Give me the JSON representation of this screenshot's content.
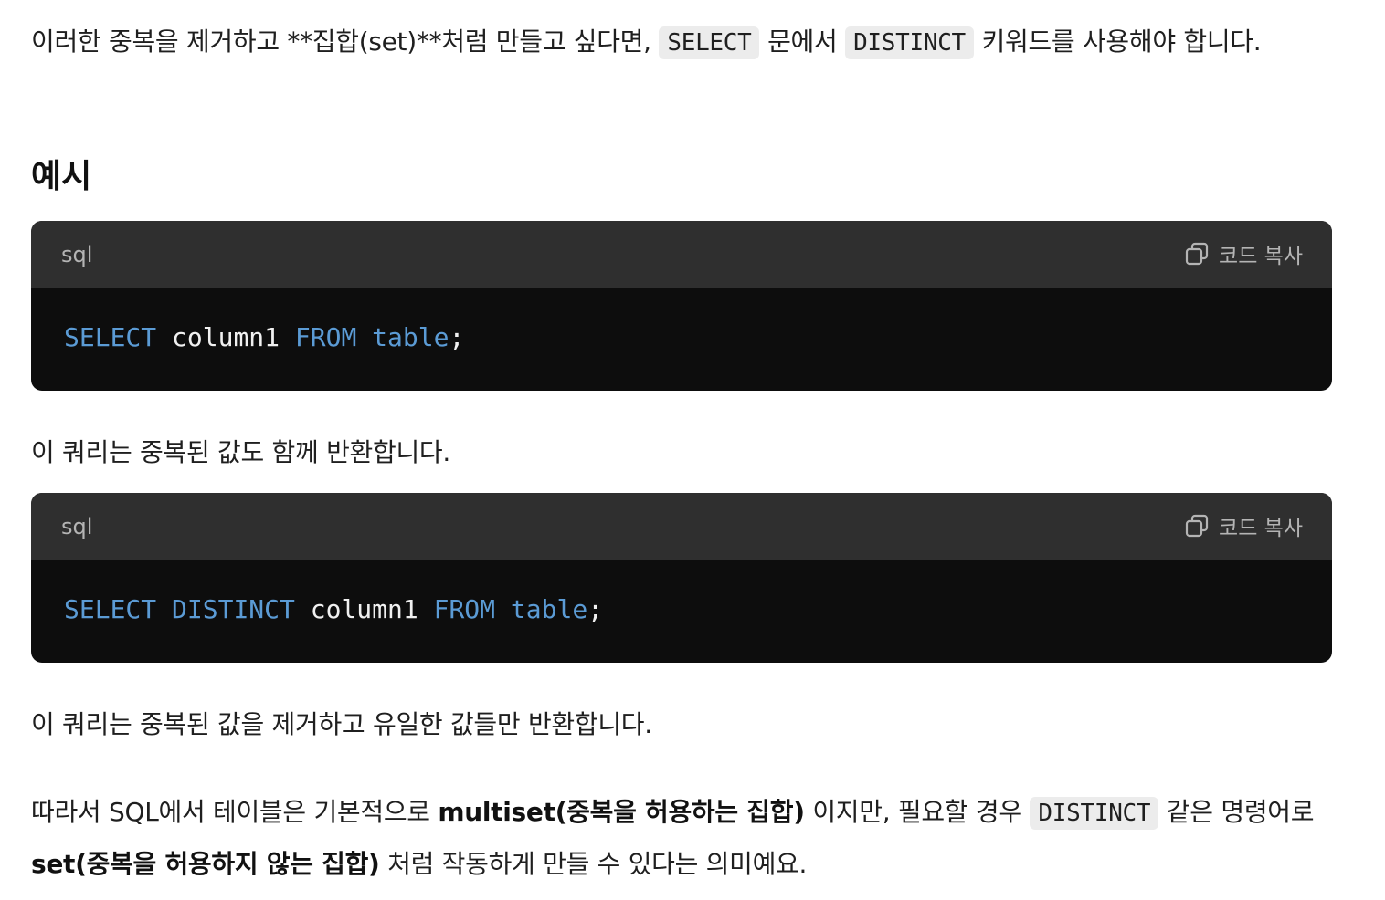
{
  "intro": {
    "text_before": "이러한 중복을 제거하고 **집합(set)**처럼 만들고 싶다면, ",
    "code1": "SELECT",
    "text_mid": " 문에서 ",
    "code2": "DISTINCT",
    "text_after": " 키워드를 사용해야 합니다."
  },
  "heading": "예시",
  "code_blocks": [
    {
      "lang": "sql",
      "copy_label": "코드 복사",
      "tokens": {
        "t1": "SELECT",
        "t2": " column1 ",
        "t3": "FROM",
        "t4": " ",
        "t5": "table",
        "t6": ";"
      }
    },
    {
      "lang": "sql",
      "copy_label": "코드 복사",
      "tokens": {
        "t1": "SELECT",
        "t2": " ",
        "t3": "DISTINCT",
        "t4": " column1 ",
        "t5": "FROM",
        "t6": " ",
        "t7": "table",
        "t8": ";"
      }
    }
  ],
  "para_after_1": "이 쿼리는 중복된 값도 함께 반환합니다.",
  "para_after_2": "이 쿼리는 중복된 값을 제거하고 유일한 값들만 반환합니다.",
  "conclusion": {
    "text1": "따라서 SQL에서 테이블은 기본적으로 ",
    "bold1": "multiset(중복을 허용하는 집합)",
    "text2": " 이지만, 필요할 경우 ",
    "code": "DISTINCT",
    "text3": " 같은 명령어로 ",
    "bold2": "set(중복을 허용하지 않는 집합)",
    "text4": " 처럼 작동하게 만들 수 있다는 의미예요."
  },
  "colors": {
    "keyword": "#5b9bd5",
    "code_bg": "#0d0d0d",
    "code_header_bg": "#2f2f2f",
    "inline_code_bg": "#ececec"
  },
  "icons": {
    "copy": "copy-icon"
  }
}
